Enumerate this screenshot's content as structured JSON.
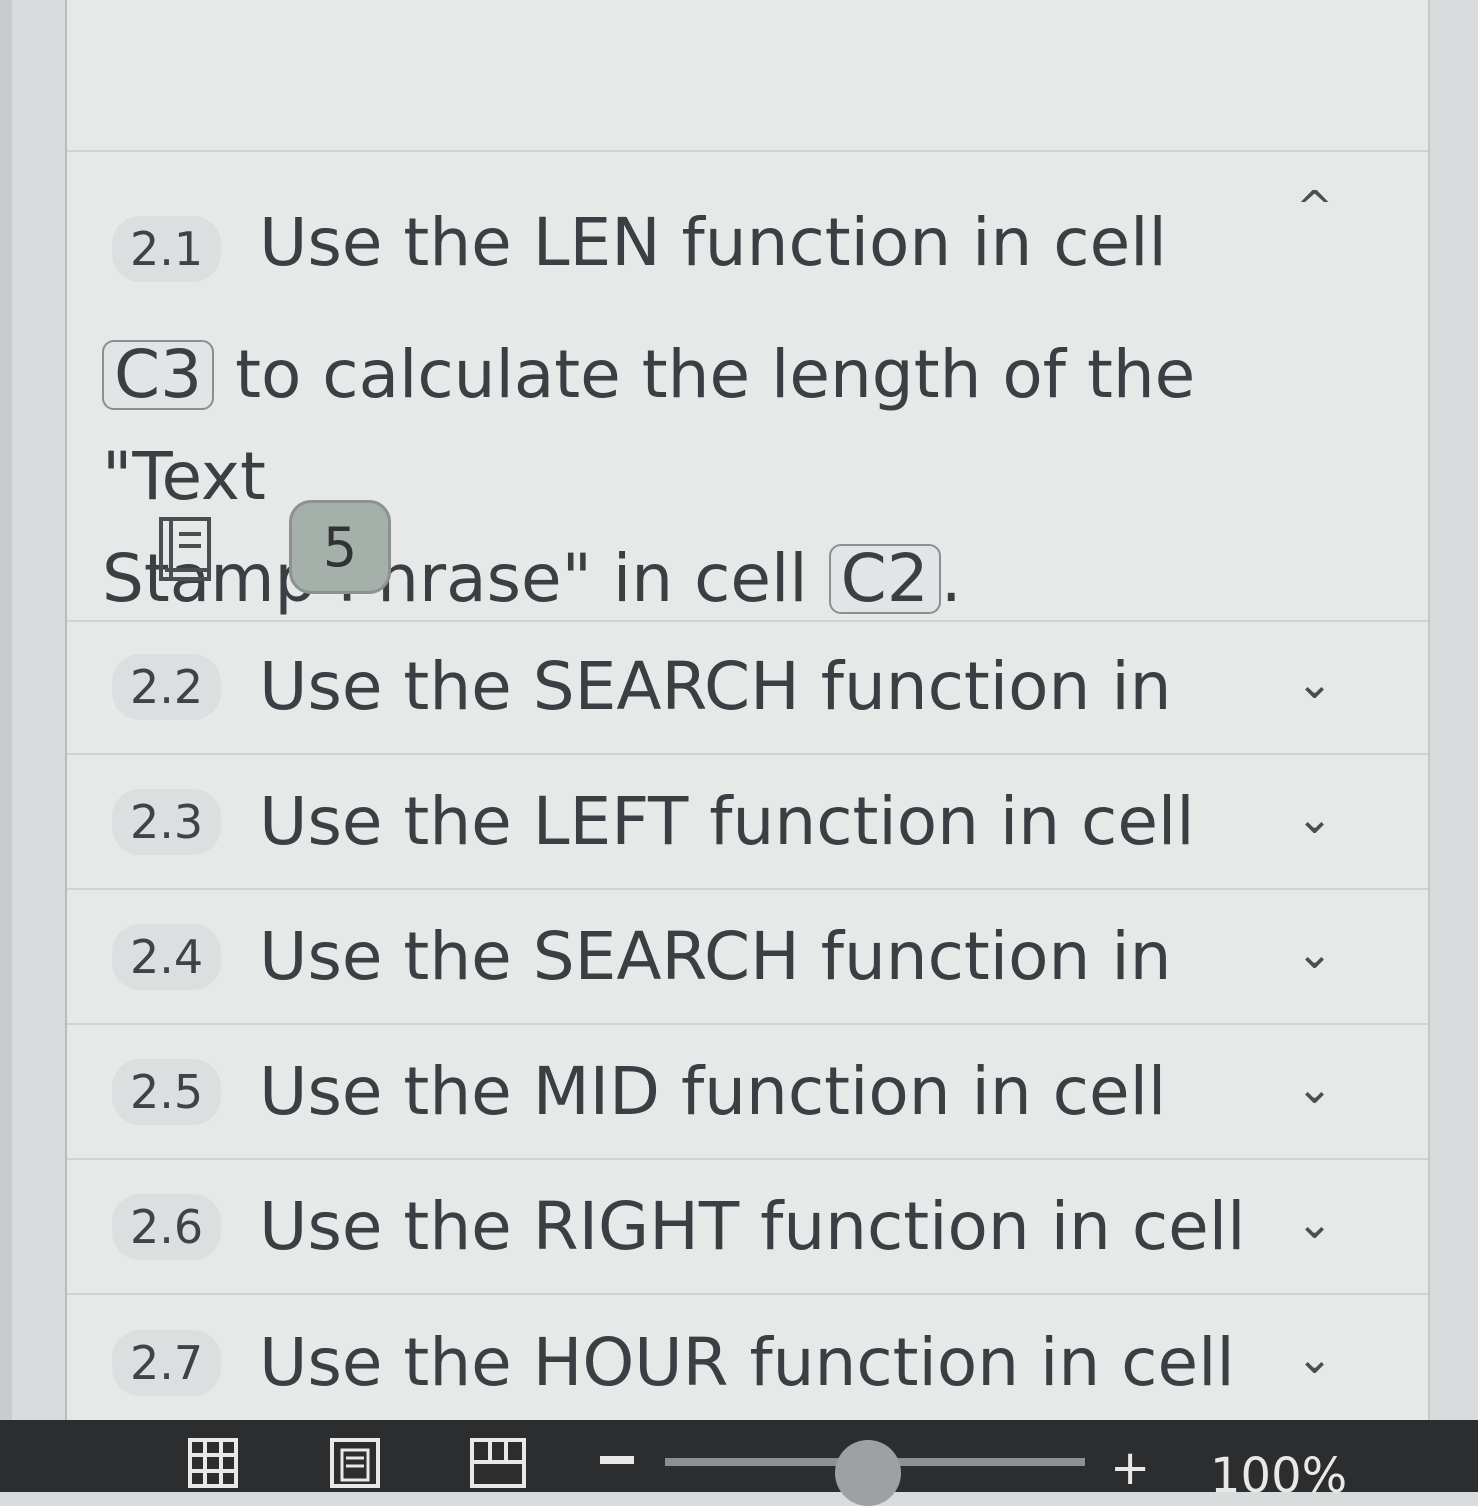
{
  "tasks": [
    {
      "number": "2.1",
      "line1": "Use the LEN function in cell",
      "cell_a": "C3",
      "line2": "to calculate the length of the \"Text",
      "line3": "Stamp Phrase\" in cell",
      "cell_b": "C2",
      "tail": ".",
      "score": "5",
      "chevron": "^",
      "expanded": true
    },
    {
      "number": "2.2",
      "label": "Use the SEARCH function in",
      "chevron": "⌄"
    },
    {
      "number": "2.3",
      "label": "Use the LEFT function in cell",
      "chevron": "⌄"
    },
    {
      "number": "2.4",
      "label": "Use the SEARCH function in",
      "chevron": "⌄"
    },
    {
      "number": "2.5",
      "label": "Use the MID function in cell",
      "chevron": "⌄"
    },
    {
      "number": "2.6",
      "label": "Use the RIGHT function in cell",
      "chevron": "⌄"
    },
    {
      "number": "2.7",
      "label": "Use the HOUR function in cell",
      "chevron": "⌄"
    }
  ],
  "statusbar": {
    "icons": [
      "normal-view-icon",
      "page-layout-icon",
      "page-break-preview-icon"
    ],
    "zoom_minus": "−",
    "zoom_plus": "+",
    "zoom_level": "100%"
  }
}
